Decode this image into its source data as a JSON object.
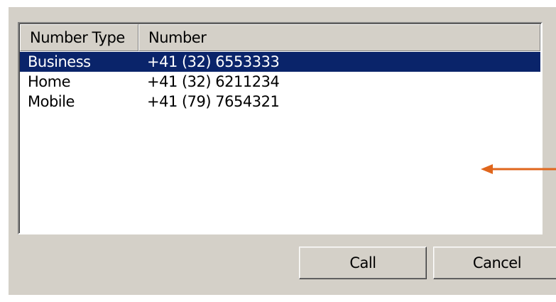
{
  "listview": {
    "columns": [
      "Number Type",
      "Number"
    ],
    "rows": [
      {
        "type": "Business",
        "number": "+41 (32) 6553333",
        "selected": true
      },
      {
        "type": "Home",
        "number": "+41 (32) 6211234",
        "selected": false
      },
      {
        "type": "Mobile",
        "number": "+41 (79) 7654321",
        "selected": false
      }
    ]
  },
  "buttons": {
    "call_label": "Call",
    "cancel_label": "Cancel"
  },
  "colors": {
    "dialog_face": "#d4d0c8",
    "selection": "#0a246a",
    "arrow": "#e0661c"
  }
}
